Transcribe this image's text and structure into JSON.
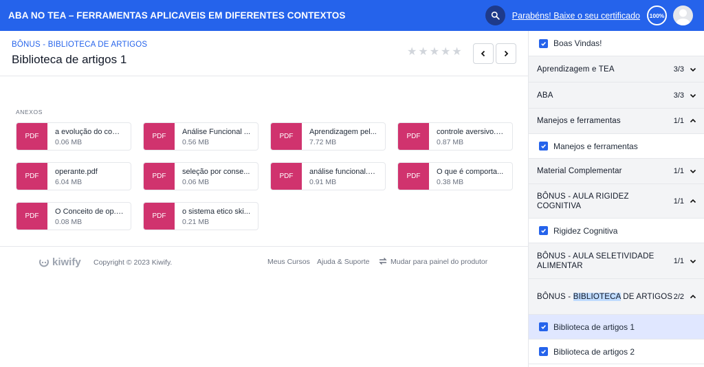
{
  "header": {
    "course_title": "ABA NO TEA – FERRAMENTAS APLICAVEIS EM DIFERENTES CONTEXTOS",
    "certificate_link": "Parabéns! Baixe o seu certificado",
    "progress": "100%"
  },
  "lesson": {
    "module": "BÔNUS - BIBLIOTECA DE ARTIGOS",
    "title": "Biblioteca de artigos 1",
    "rating": 0
  },
  "attachments": {
    "label": "ANEXOS",
    "badge": "PDF",
    "files": [
      {
        "name": "a evolução do com...",
        "size": "0.06 MB"
      },
      {
        "name": "Análise Funcional ...",
        "size": "0.56 MB"
      },
      {
        "name": "Aprendizagem pel...",
        "size": "7.72 MB"
      },
      {
        "name": "controle aversivo.p...",
        "size": "0.87 MB"
      },
      {
        "name": "operante.pdf",
        "size": "6.04 MB"
      },
      {
        "name": "seleção por conse...",
        "size": "0.06 MB"
      },
      {
        "name": "análise funcional.pdf",
        "size": "0.91 MB"
      },
      {
        "name": "O que é comporta...",
        "size": "0.38 MB"
      },
      {
        "name": "O Conceito de op. ...",
        "size": "0.08 MB"
      },
      {
        "name": "o sistema etico ski...",
        "size": "0.21 MB"
      }
    ]
  },
  "footer": {
    "brand": "kiwify",
    "copyright": "Copyright © 2023 Kiwify.",
    "my_courses": "Meus Cursos",
    "help": "Ajuda & Suporte",
    "switch_panel": "Mudar para painel do produtor"
  },
  "sidebar": {
    "lessons": [
      {
        "label": "Boas Vindas!"
      },
      {
        "label": "Manejos e ferramentas"
      },
      {
        "label": "Rigidez Cognitiva"
      },
      {
        "label": "Biblioteca de artigos 1"
      },
      {
        "label": "Biblioteca de artigos 2"
      }
    ],
    "modules": [
      {
        "title": "Aprendizagem e TEA",
        "count": "3/3"
      },
      {
        "title": "ABA",
        "count": "3/3"
      },
      {
        "title": "Manejos e ferramentas",
        "count": "1/1"
      },
      {
        "title": "Material Complementar",
        "count": "1/1"
      },
      {
        "title": "BÔNUS - AULA RIGIDEZ COGNITIVA",
        "count": "1/1"
      },
      {
        "title": "BÔNUS - AULA SELETIVIDADE ALIMENTAR",
        "count": "1/1"
      },
      {
        "title_pre": "BÔNUS - ",
        "title_hl": "BIBLIOTECA",
        "title_post": " DE ARTIGOS",
        "count": "2/2"
      }
    ]
  },
  "colors": {
    "primary": "#2563eb",
    "pdf_badge": "#d0336e",
    "active_lesson": "#e0e7ff"
  }
}
